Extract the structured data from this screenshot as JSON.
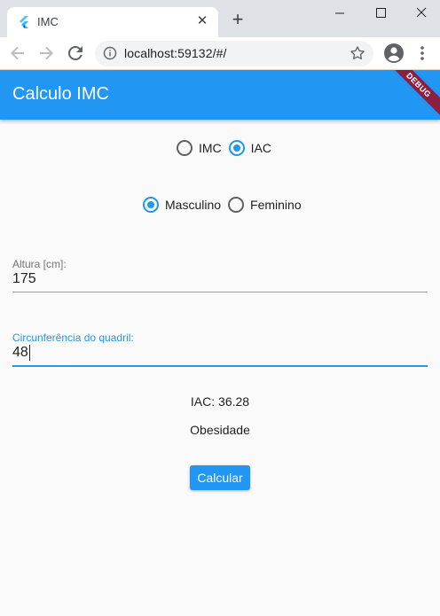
{
  "browser": {
    "tab_title": "IMC",
    "new_tab": "+",
    "close_tab": "✕",
    "url": "localhost:59132/#/"
  },
  "app": {
    "title": "Calculo IMC",
    "debug_banner": "DEBUG",
    "accent_color": "#2196f3"
  },
  "mode": {
    "options": [
      "IMC",
      "IAC"
    ],
    "selected": "IAC"
  },
  "sex": {
    "options": [
      "Masculino",
      "Feminino"
    ],
    "selected": "Masculino"
  },
  "fields": {
    "altura": {
      "label": "Altura [cm]:",
      "value": "175"
    },
    "quadril": {
      "label": "Circunferência do quadril:",
      "value": "48"
    }
  },
  "result": {
    "value_text": "IAC: 36.28",
    "classification": "Obesidade"
  },
  "button": {
    "label": "Calcular"
  }
}
